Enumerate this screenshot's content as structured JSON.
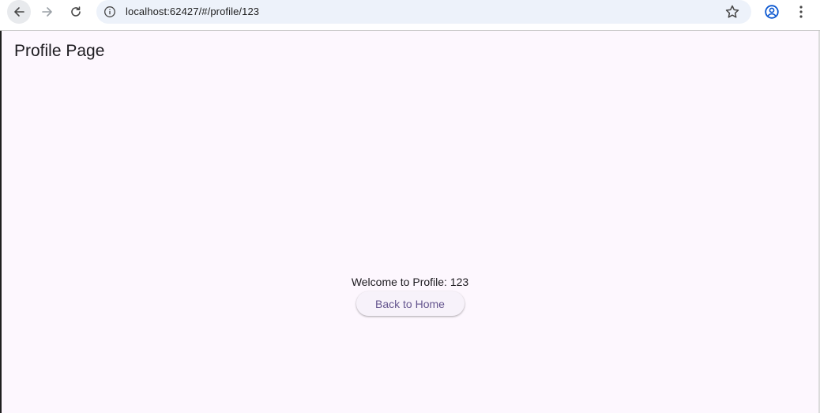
{
  "browser": {
    "url": "localhost:62427/#/profile/123",
    "icons": {
      "back": "arrow-left-icon",
      "forward": "arrow-right-icon",
      "reload": "reload-icon",
      "site_info": "info-icon",
      "bookmark": "star-icon",
      "profile": "account-circle-icon",
      "menu": "more-vertical-icon"
    }
  },
  "app": {
    "title": "Profile Page",
    "welcome_text": "Welcome to Profile: 123",
    "back_button_label": "Back to Home",
    "colors": {
      "background": "#fdf7fe",
      "button_text": "#65558f",
      "button_bg": "#f7f2fa",
      "text": "#1d1b20",
      "omnibox_bg": "#edf2fa",
      "profile_icon": "#0b57d0"
    }
  }
}
